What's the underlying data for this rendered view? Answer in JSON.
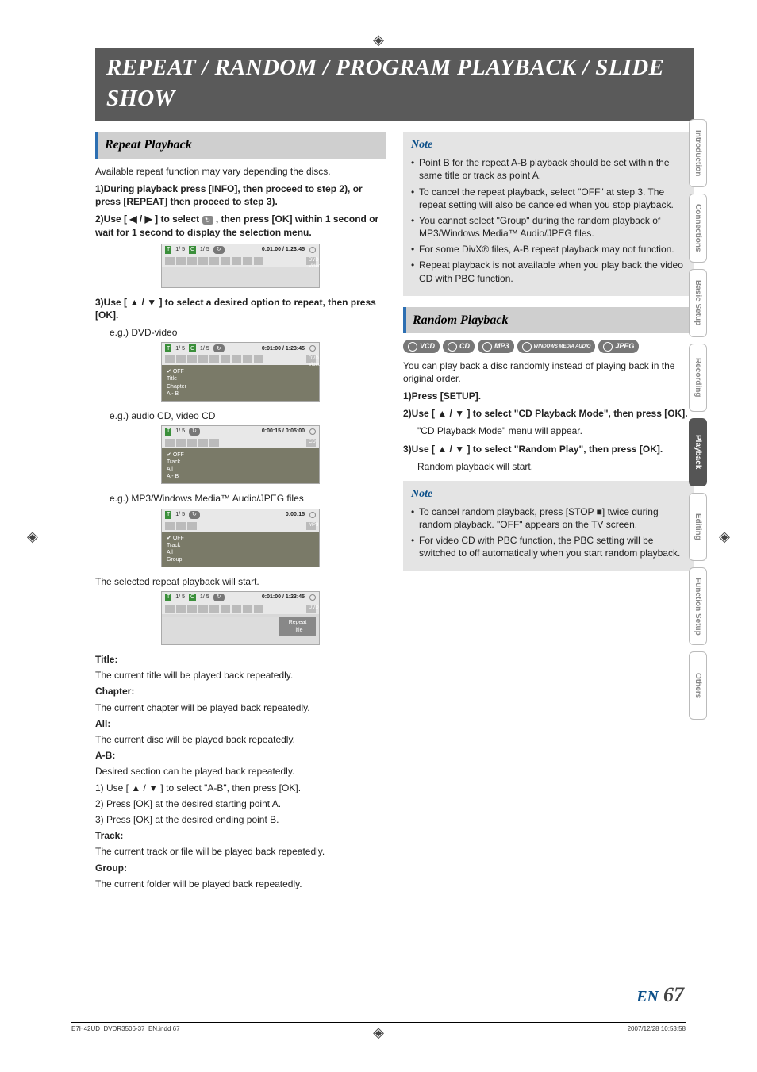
{
  "page_title": "REPEAT / RANDOM / PROGRAM PLAYBACK / SLIDE SHOW",
  "sections": {
    "repeat": {
      "heading": "Repeat Playback",
      "intro": "Available repeat function may vary depending the discs.",
      "step1": "During playback press [INFO], then proceed to step 2), or press [REPEAT] then proceed to step 3).",
      "step2a": "Use [ ◀ / ▶ ] to select ",
      "step2b": " , then press [OK] within 1 second or wait for 1 second to display the selection menu.",
      "step3": "Use [ ▲ / ▼ ] to select a desired option to repeat, then press [OK].",
      "eg_dvd": "e.g.) DVD-video",
      "eg_cd": "e.g.) audio CD, video CD",
      "eg_mp3": "e.g.) MP3/Windows Media™ Audio/JPEG files",
      "selected_start": "The selected repeat playback will start.",
      "osd1": {
        "tc": "1/  5",
        "cc": "1/  5",
        "time": "0:01:00 / 1:23:45",
        "badge": "DVD  Video"
      },
      "osd_dvd": {
        "tc": "1/  5",
        "cc": "1/  5",
        "time": "0:01:00 / 1:23:45",
        "badge": "DVD  Video",
        "menu": [
          "OFF",
          "Title",
          "Chapter",
          "A - B"
        ]
      },
      "osd_cd": {
        "tc": "1/  5",
        "time": "0:00:15 / 0:05:00",
        "badge": "CD",
        "menu": [
          "OFF",
          "Track",
          "All",
          "A - B"
        ]
      },
      "osd_mp3": {
        "tc": "1/  5",
        "time": "0:00:15",
        "badge": "MP3",
        "menu": [
          "OFF",
          "Track",
          "All",
          "Group"
        ]
      },
      "osd_rep": {
        "tc": "1/  5",
        "cc": "1/  5",
        "time": "0:01:00 / 1:23:45",
        "badge": "DVD",
        "repeat": [
          "Repeat",
          "Title"
        ]
      },
      "defs": {
        "title_h": "Title:",
        "title_b": "The current title will be played back repeatedly.",
        "chapter_h": "Chapter:",
        "chapter_b": "The current chapter will be played back repeatedly.",
        "all_h": "All:",
        "all_b": "The current disc will be played back repeatedly.",
        "ab_h": "A-B:",
        "ab_b1": "Desired section can be played back repeatedly.",
        "ab_b2": "1) Use [ ▲ / ▼ ] to select \"A-B\", then press [OK].",
        "ab_b3": "2) Press [OK] at the desired starting point A.",
        "ab_b4": "3) Press [OK] at the desired ending point B.",
        "track_h": "Track:",
        "track_b": "The current track or file will be played back repeatedly.",
        "group_h": "Group:",
        "group_b": "The current folder will be played back repeatedly."
      }
    },
    "note1": {
      "heading": "Note",
      "items": [
        "Point B for the repeat A-B playback should be set within the same title or track as point A.",
        "To cancel the repeat playback, select \"OFF\" at step 3. The repeat setting will also be canceled when you stop playback.",
        "You cannot select \"Group\" during the random playback of MP3/Windows Media™ Audio/JPEG files.",
        "For some DivX® files, A-B repeat playback may not function.",
        "Repeat playback is not available when you play back the video CD with PBC function."
      ]
    },
    "random": {
      "heading": "Random Playback",
      "badges": [
        "VCD",
        "CD",
        "MP3",
        "WINDOWS MEDIA AUDIO",
        "JPEG"
      ],
      "intro": "You can play back a disc randomly instead of playing back in the original order.",
      "s1": "Press [SETUP].",
      "s2": "Use [ ▲ / ▼ ] to select \"CD Playback Mode\", then press [OK].",
      "s2b": "\"CD Playback Mode\" menu will appear.",
      "s3": "Use [ ▲ / ▼ ] to select \"Random Play\", then press [OK].",
      "s3b": "Random playback will start."
    },
    "note2": {
      "heading": "Note",
      "items": [
        "To cancel random playback, press [STOP ■] twice during random playback. \"OFF\" appears on the TV screen.",
        "For video CD with PBC function, the PBC setting will be switched to off automatically when you start random playback."
      ]
    }
  },
  "side_tabs": [
    "Introduction",
    "Connections",
    "Basic Setup",
    "Recording",
    "Playback",
    "Editing",
    "Function Setup",
    "Others"
  ],
  "active_tab": "Playback",
  "page_label": "EN",
  "page_number": "67",
  "footer_left": "E7H42UD_DVDR3506-37_EN.indd   67",
  "footer_right": "2007/12/28   10:53:58",
  "labels": {
    "step1_prefix": "1)",
    "step2_prefix": "2)",
    "step3_prefix": "3)",
    "T": "T",
    "C": "C"
  }
}
